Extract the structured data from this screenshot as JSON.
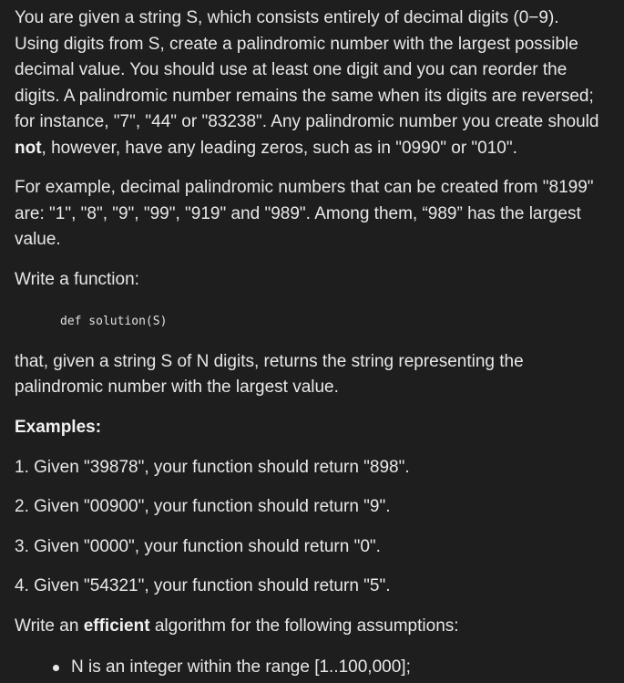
{
  "intro": {
    "line1": "You are given a string S, which consists entirely of decimal digits (0−9).",
    "line2": "Using digits from S, create a palindromic number with the largest possible",
    "line3": "decimal value. You should use at least one digit and you can reorder the",
    "line4": "digits. A palindromic number remains the same when its digits are reversed;",
    "line5": "for instance, \"7\", \"44\" or \"83238\". Any palindromic number you create should",
    "line6_bold": "not",
    "line6_rest": ", however, have any leading zeros, such as in \"0990\" or \"010\"."
  },
  "example_text": {
    "line1": "For example, decimal palindromic numbers that can be created from \"8199\"",
    "line2": "are: \"1\", \"8\", \"9\", \"99\", \"919\" and \"989\". Among them, “989” has the largest",
    "line3": "value."
  },
  "write_function": "Write a function:",
  "code": "def solution(S)",
  "returns": {
    "line1": "that, given a string S of N digits, returns the string representing the",
    "line2": "palindromic number with the largest value."
  },
  "examples_heading": "Examples:",
  "examples": [
    "1. Given \"39878\", your function should return \"898\".",
    "2. Given \"00900\", your function should return \"9\".",
    "3. Given \"0000\", your function should return \"0\".",
    "4. Given \"54321\", your function should return \"5\"."
  ],
  "efficient": {
    "prefix": "Write an ",
    "bold": "efficient",
    "suffix": " algorithm for the following assumptions:"
  },
  "assumptions": [
    "N is an integer within the range [1..100,000];"
  ]
}
